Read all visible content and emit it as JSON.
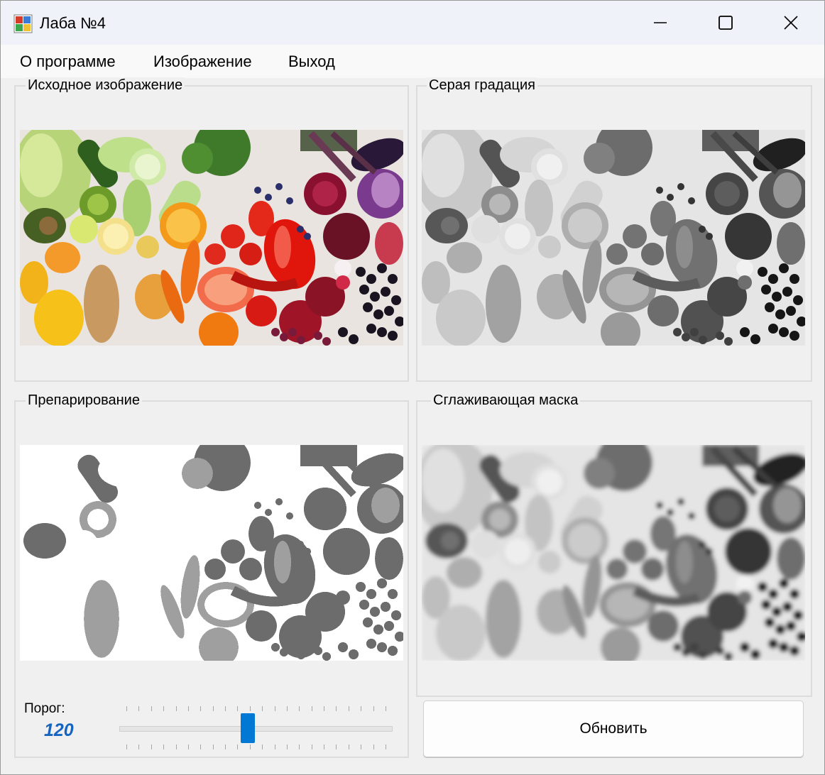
{
  "window": {
    "title": "Лаба №4",
    "controls": [
      "minimize-icon",
      "maximize-icon",
      "close-icon"
    ]
  },
  "menu": {
    "items": [
      "О программе",
      "Изображение",
      "Выход"
    ]
  },
  "panels": {
    "original": {
      "label": "Исходное изображение"
    },
    "grayscale": {
      "label": "Серая градация"
    },
    "threshold": {
      "label": "Препарирование"
    },
    "smoothing": {
      "label": "Сглаживающая маска"
    }
  },
  "threshold": {
    "label": "Порог:",
    "value": "120",
    "slider_level": 0.47
  },
  "refresh_button": {
    "label": "Обновить"
  },
  "colors": {
    "accent": "#0078d4",
    "threshold_value_text": "#1565c0"
  }
}
